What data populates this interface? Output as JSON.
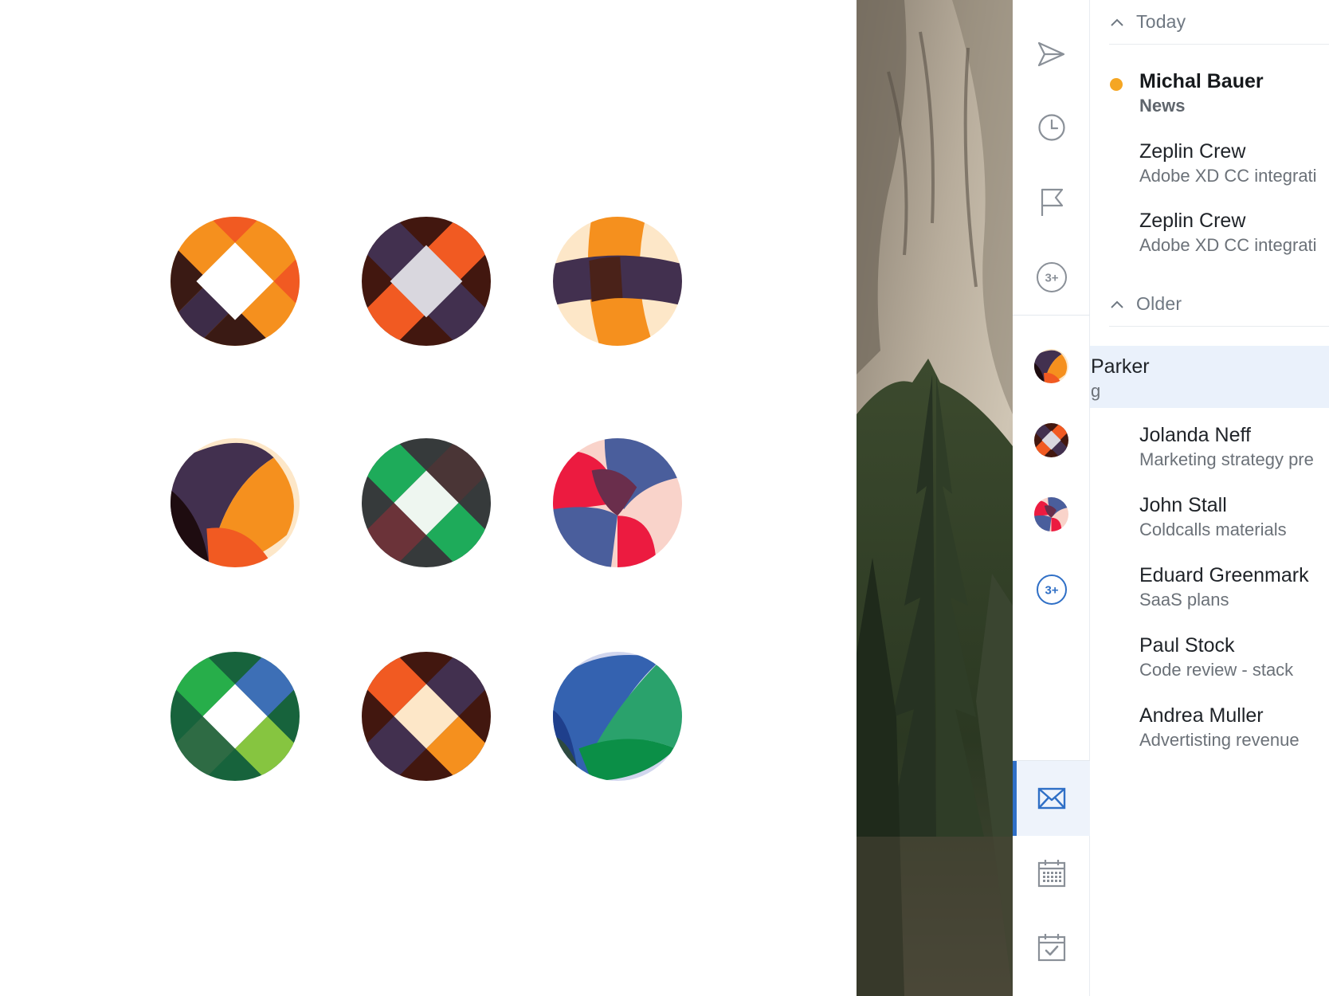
{
  "colors": {
    "accent": "#2f6fc6",
    "unread_dot": "#f5a623",
    "selected_row": "#eaf1fb",
    "rail_icon": "#8a9098"
  },
  "showcase": {
    "avatars": [
      {
        "icon": "orange-diamond-avatar-icon"
      },
      {
        "icon": "dark-diamond-avatar-icon"
      },
      {
        "icon": "orange-band-avatar-icon"
      },
      {
        "icon": "orange-crescent-avatar-icon"
      },
      {
        "icon": "green-diamond-avatar-icon"
      },
      {
        "icon": "red-blue-weave-avatar-icon"
      },
      {
        "icon": "green-blue-diamond-avatar-icon"
      },
      {
        "icon": "cream-diamond-avatar-icon"
      },
      {
        "icon": "blue-green-leaf-avatar-icon"
      }
    ]
  },
  "rail": {
    "top_icons": [
      "send-icon",
      "clock-icon",
      "flag-icon"
    ],
    "top_more": "3+",
    "contact_more": "3+",
    "bottom_icons": [
      "mail-icon",
      "calendar-icon",
      "tasks-icon"
    ]
  },
  "list": {
    "sections": [
      {
        "label": "Today"
      },
      {
        "label": "Older"
      }
    ],
    "today": [
      {
        "name": "Michal Bauer",
        "subject": "News",
        "unread": true
      },
      {
        "name": "Zeplin Crew",
        "subject": "Adobe XD CC integrati"
      },
      {
        "name": "Zeplin Crew",
        "subject": "Adobe XD CC integrati"
      }
    ],
    "older": [
      {
        "name": "Parker",
        "subject": "g",
        "selected": true
      },
      {
        "name": "Jolanda Neff",
        "subject": "Marketing strategy pre"
      },
      {
        "name": "John Stall",
        "subject": "Coldcalls materials"
      },
      {
        "name": "Eduard Greenmark",
        "subject": "SaaS plans"
      },
      {
        "name": "Paul Stock",
        "subject": "Code review - stack"
      },
      {
        "name": "Andrea Muller",
        "subject": "Advertisting revenue"
      }
    ]
  }
}
